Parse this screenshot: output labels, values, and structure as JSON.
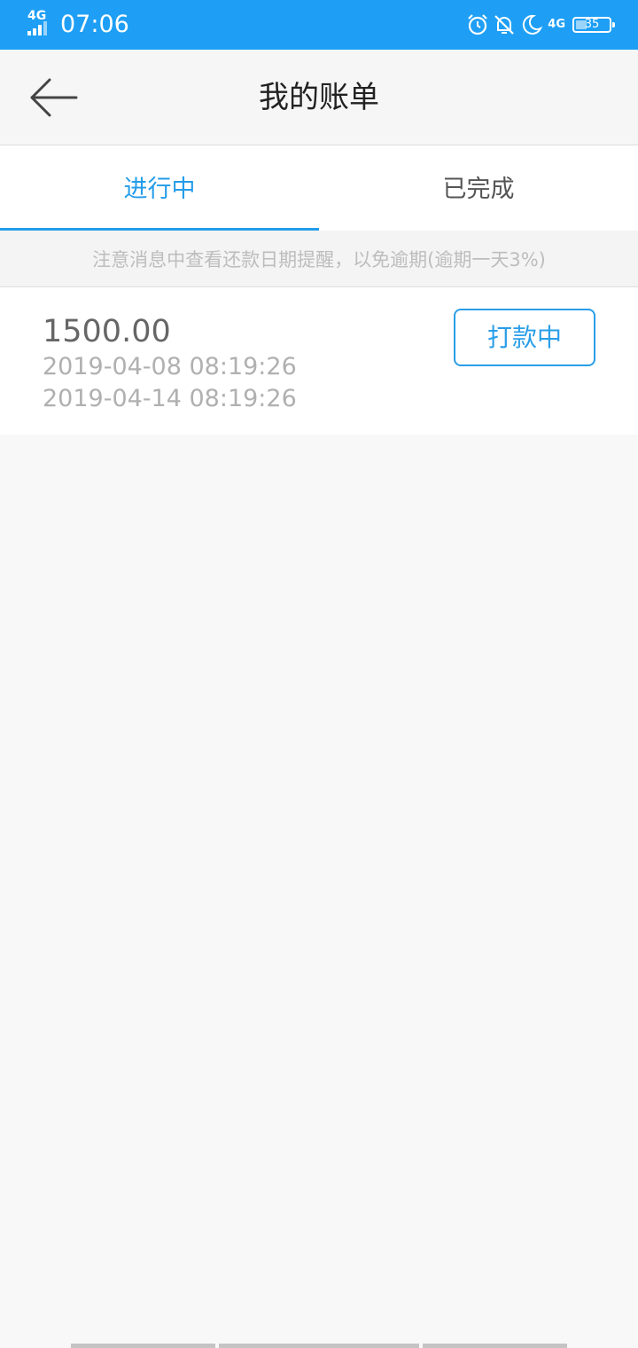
{
  "status_bar": {
    "network": "4G",
    "time": "07:06",
    "network_right": "4G",
    "battery": "35"
  },
  "header": {
    "title": "我的账单"
  },
  "tabs": [
    {
      "label": "进行中",
      "active": true
    },
    {
      "label": "已完成",
      "active": false
    }
  ],
  "notice": "注意消息中查看还款日期提醒，以免逾期(逾期一天3%)",
  "bills": [
    {
      "amount": "1500.00",
      "date_start": "2019-04-08 08:19:26",
      "date_end": "2019-04-14 08:19:26",
      "status": "打款中"
    }
  ],
  "colors": {
    "status_bar": "#1e9ff5",
    "accent": "#239cea"
  }
}
